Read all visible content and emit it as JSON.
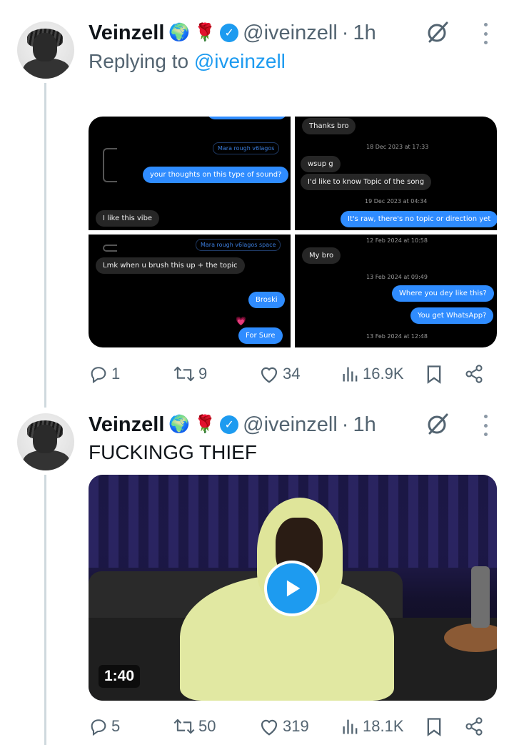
{
  "tweets": [
    {
      "name": "Veinzell",
      "emoji_globe": "🌍",
      "emoji_rose": "🌹",
      "handle": "@iveinzell",
      "separator": "·",
      "time": "1h",
      "replying_prefix": "Replying to",
      "replying_mention": "@iveinzell",
      "screenshots": {
        "cell1": {
          "file_chip": "Mara rough v6lagos",
          "outgoing": "your thoughts on this type of sound?",
          "incoming": "I like this vibe"
        },
        "cell2": {
          "incoming1": "Thanks bro",
          "stamp1": "18 Dec 2023 at 17:33",
          "incoming2": "wsup g",
          "incoming3": "I'd like to know Topic of the song",
          "stamp2": "19 Dec 2023 at 04:34",
          "outgoing": "It's raw, there's no topic or direction yet"
        },
        "cell3": {
          "file_chip": "Mara rough v6lagos space",
          "incoming": "Lmk when u brush this up + the topic",
          "outgoing1": "Broski",
          "reaction": "💗",
          "outgoing2": "For Sure"
        },
        "cell4": {
          "stamp1": "12 Feb 2024 at 10:58",
          "incoming": "My bro",
          "stamp2": "13 Feb 2024 at 09:49",
          "outgoing1": "Where you dey like this?",
          "outgoing2": "You get WhatsApp?",
          "stamp3": "13 Feb 2024 at 12:48"
        }
      },
      "stats": {
        "replies": "1",
        "reposts": "9",
        "likes": "34",
        "views": "16.9K"
      }
    },
    {
      "name": "Veinzell",
      "emoji_globe": "🌍",
      "emoji_rose": "🌹",
      "handle": "@iveinzell",
      "separator": "·",
      "time": "1h",
      "text": "FUCKINGG THIEF",
      "video": {
        "duration": "1:40"
      },
      "stats": {
        "replies": "5",
        "reposts": "50",
        "likes": "319",
        "views": "18.1K"
      }
    }
  ],
  "colors": {
    "accent": "#1d9bf0",
    "muted": "#536471",
    "thread_line": "#cfd9de"
  },
  "icons": [
    "reply-icon",
    "repost-icon",
    "like-icon",
    "views-icon",
    "bookmark-icon",
    "share-icon",
    "grok-icon",
    "more-icon",
    "verified-badge-icon",
    "play-icon"
  ]
}
